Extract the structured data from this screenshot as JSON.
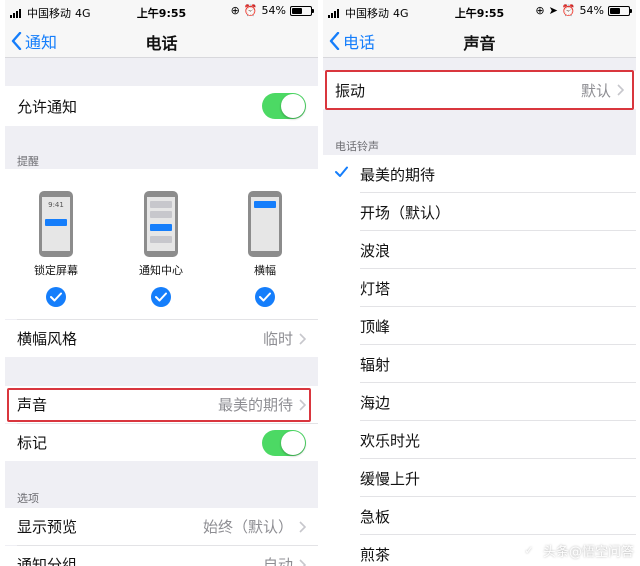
{
  "left": {
    "status": {
      "carrier": "中国移动",
      "network": "4G",
      "time": "上午9:55",
      "battery": "54%",
      "battery_fraction": 0.54
    },
    "nav": {
      "back": "通知",
      "title": "电话"
    },
    "allow_notifications": {
      "label": "允许通知",
      "on": true
    },
    "alerts_header": "提醒",
    "alert_styles": [
      {
        "label": "锁定屏幕",
        "checked": true,
        "phone_time": "9:41"
      },
      {
        "label": "通知中心",
        "checked": true
      },
      {
        "label": "横幅",
        "checked": true
      }
    ],
    "banner_style": {
      "label": "横幅风格",
      "value": "临时"
    },
    "sounds": {
      "label": "声音",
      "value": "最美的期待"
    },
    "badges": {
      "label": "标记",
      "on": true
    },
    "options_header": "选项",
    "show_previews": {
      "label": "显示预览",
      "value": "始终（默认）"
    },
    "grouping": {
      "label": "通知分组",
      "value": "自动"
    }
  },
  "right": {
    "status": {
      "carrier": "中国移动",
      "network": "4G",
      "time": "上午9:55",
      "battery": "54%",
      "battery_fraction": 0.54
    },
    "nav": {
      "back": "电话",
      "title": "声音"
    },
    "vibration": {
      "label": "振动",
      "value": "默认"
    },
    "ringtones_header": "电话铃声",
    "ringtones": [
      {
        "label": "最美的期待",
        "selected": true
      },
      {
        "label": "开场（默认）",
        "selected": false
      },
      {
        "label": "波浪",
        "selected": false
      },
      {
        "label": "灯塔",
        "selected": false
      },
      {
        "label": "顶峰",
        "selected": false
      },
      {
        "label": "辐射",
        "selected": false
      },
      {
        "label": "海边",
        "selected": false
      },
      {
        "label": "欢乐时光",
        "selected": false
      },
      {
        "label": "缓慢上升",
        "selected": false
      },
      {
        "label": "急板",
        "selected": false
      },
      {
        "label": "煎茶",
        "selected": false
      }
    ]
  },
  "watermark": {
    "text": "头条@悟空问答"
  },
  "colors": {
    "accent": "#157efb",
    "switch_on": "#4cd964",
    "highlight": "#d9363e",
    "background": "#efeff4"
  }
}
